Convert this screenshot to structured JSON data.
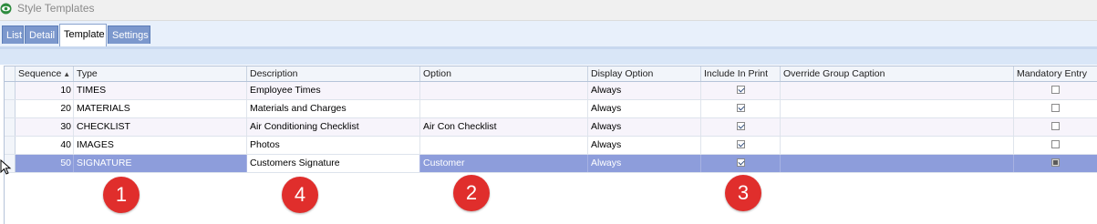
{
  "window": {
    "title": "Style Templates"
  },
  "tabs": [
    {
      "label": "List",
      "active": false
    },
    {
      "label": "Detail",
      "active": false
    },
    {
      "label": "Template",
      "active": true
    },
    {
      "label": "Settings",
      "active": false
    }
  ],
  "grid": {
    "columns": [
      "Sequence",
      "Type",
      "Description",
      "Option",
      "Display Option",
      "Include In Print",
      "Override Group Caption",
      "Mandatory Entry"
    ],
    "rows": [
      {
        "sequence": "10",
        "type": "TIMES",
        "description": "Employee Times",
        "option": "",
        "display_option": "Always",
        "include_in_print": true,
        "override_group_caption": "",
        "mandatory_entry": false
      },
      {
        "sequence": "20",
        "type": "MATERIALS",
        "description": "Materials and Charges",
        "option": "",
        "display_option": "Always",
        "include_in_print": true,
        "override_group_caption": "",
        "mandatory_entry": false
      },
      {
        "sequence": "30",
        "type": "CHECKLIST",
        "description": "Air Conditioning Checklist",
        "option": "Air Con Checklist",
        "display_option": "Always",
        "include_in_print": true,
        "override_group_caption": "",
        "mandatory_entry": false
      },
      {
        "sequence": "40",
        "type": "IMAGES",
        "description": "Photos",
        "option": "",
        "display_option": "Always",
        "include_in_print": true,
        "override_group_caption": "",
        "mandatory_entry": false
      },
      {
        "sequence": "50",
        "type": "SIGNATURE",
        "description": "Customers Signature",
        "option": "Customer",
        "display_option": "Always",
        "include_in_print": true,
        "override_group_caption": "",
        "mandatory_entry": true
      }
    ]
  },
  "annotations": [
    "1",
    "4",
    "2",
    "3"
  ],
  "colors": {
    "badge": "#e02e2c",
    "selected_row": "#8d9ddb",
    "tab_inactive": "#7c98cd"
  }
}
